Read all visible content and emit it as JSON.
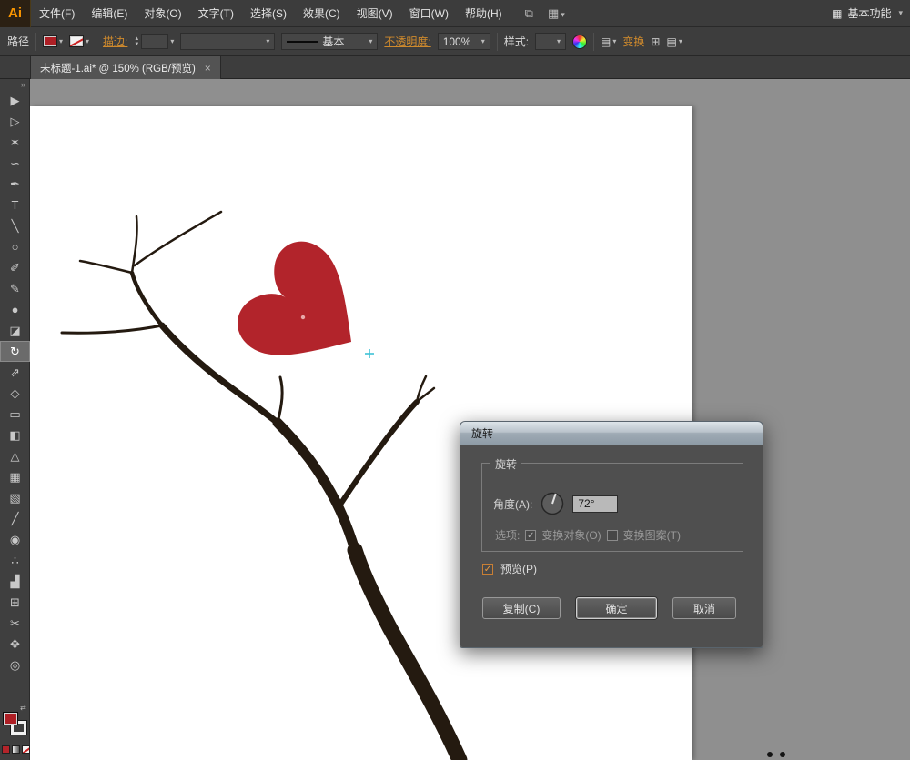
{
  "colors": {
    "ui_bg": "#3d3d3d",
    "canvas_bg": "#8f8f8f",
    "accent_orange": "#cf8a2d",
    "logo_orange": "#f79400",
    "fill_red": "#ae1f25",
    "heart_red": "#b2242b",
    "branch_color": "#241a10",
    "selection_cyan": "#3ec1d6",
    "dialog_bg": "#4f4f4f"
  },
  "icons": {
    "dropdown": "▾",
    "double_chevron": "»",
    "close": "×",
    "check": "✓",
    "bridge": "⧉",
    "arrange": "▦",
    "grid": "⊞",
    "panel": "▤",
    "swap": "⇄",
    "workspace": "▦"
  },
  "menubar": {
    "logo": "Ai",
    "items": [
      {
        "name": "menu-file",
        "label": "文件(F)"
      },
      {
        "name": "menu-edit",
        "label": "编辑(E)"
      },
      {
        "name": "menu-object",
        "label": "对象(O)"
      },
      {
        "name": "menu-type",
        "label": "文字(T)"
      },
      {
        "name": "menu-select",
        "label": "选择(S)"
      },
      {
        "name": "menu-effect",
        "label": "效果(C)"
      },
      {
        "name": "menu-view",
        "label": "视图(V)"
      },
      {
        "name": "menu-window",
        "label": "窗口(W)"
      },
      {
        "name": "menu-help",
        "label": "帮助(H)"
      }
    ],
    "workspace": "基本功能"
  },
  "controlbar": {
    "context_label": "路径",
    "stroke_label": "描边:",
    "stroke_weight_value": "",
    "brush_value": "基本",
    "opacity_label": "不透明度:",
    "opacity_value": "100%",
    "style_label": "样式:",
    "transform_label": "变换"
  },
  "tab": {
    "title": "未标题-1.ai* @ 150% (RGB/预览)"
  },
  "toolbar": {
    "tools": [
      {
        "name": "selection-tool",
        "glyph": "▶"
      },
      {
        "name": "direct-selection-tool",
        "glyph": "▷"
      },
      {
        "name": "magic-wand-tool",
        "glyph": "✶"
      },
      {
        "name": "lasso-tool",
        "glyph": "∽"
      },
      {
        "name": "pen-tool",
        "glyph": "✒"
      },
      {
        "name": "type-tool",
        "glyph": "T"
      },
      {
        "name": "line-segment-tool",
        "glyph": "╲"
      },
      {
        "name": "ellipse-tool",
        "glyph": "○"
      },
      {
        "name": "paintbrush-tool",
        "glyph": "✐"
      },
      {
        "name": "pencil-tool",
        "glyph": "✎"
      },
      {
        "name": "blob-brush-tool",
        "glyph": "●"
      },
      {
        "name": "eraser-tool",
        "glyph": "◪"
      },
      {
        "name": "rotate-tool",
        "glyph": "↻",
        "active": true
      },
      {
        "name": "scale-tool",
        "glyph": "⇗"
      },
      {
        "name": "width-tool",
        "glyph": "◇"
      },
      {
        "name": "free-transform-tool",
        "glyph": "▭"
      },
      {
        "name": "shape-builder-tool",
        "glyph": "◧"
      },
      {
        "name": "perspective-grid-tool",
        "glyph": "△"
      },
      {
        "name": "mesh-tool",
        "glyph": "▦"
      },
      {
        "name": "gradient-tool",
        "glyph": "▧"
      },
      {
        "name": "eyedropper-tool",
        "glyph": "╱"
      },
      {
        "name": "blend-tool",
        "glyph": "◉"
      },
      {
        "name": "symbol-sprayer-tool",
        "glyph": "∴"
      },
      {
        "name": "column-graph-tool",
        "glyph": "▟"
      },
      {
        "name": "artboard-tool",
        "glyph": "⊞"
      },
      {
        "name": "slice-tool",
        "glyph": "✂"
      },
      {
        "name": "hand-tool",
        "glyph": "✥"
      },
      {
        "name": "zoom-tool",
        "glyph": "◎"
      }
    ]
  },
  "dialog": {
    "title": "旋转",
    "group_label": "旋转",
    "angle_label": "角度(A):",
    "angle_value": "72°",
    "options_label": "选项:",
    "option_object": "变换对象(O)",
    "option_pattern": "变换图案(T)",
    "preview_label": "预览(P)",
    "copy_button": "复制(C)",
    "ok_button": "确定",
    "cancel_button": "取消"
  }
}
